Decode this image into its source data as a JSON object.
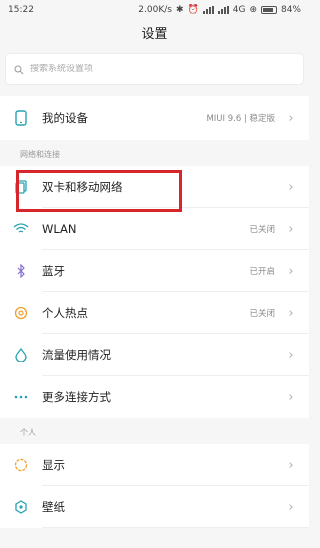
{
  "status_bar": {
    "time": "15:22",
    "speed": "2.00K/s",
    "network_type": "4G",
    "battery": "84%"
  },
  "header": {
    "title": "设置"
  },
  "search": {
    "placeholder": "搜索系统设置项"
  },
  "device": {
    "label": "我的设备",
    "value": "MIUI 9.6 | 稳定版"
  },
  "sections": {
    "network_title": "网络和连接",
    "personal_title": "个人"
  },
  "network_items": [
    {
      "label": "双卡和移动网络",
      "value": "",
      "icon": "sim-card-icon"
    },
    {
      "label": "WLAN",
      "value": "已关闭",
      "icon": "wifi-icon"
    },
    {
      "label": "蓝牙",
      "value": "已开启",
      "icon": "bluetooth-icon"
    },
    {
      "label": "个人热点",
      "value": "已关闭",
      "icon": "hotspot-icon"
    },
    {
      "label": "流量使用情况",
      "value": "",
      "icon": "data-usage-icon"
    },
    {
      "label": "更多连接方式",
      "value": "",
      "icon": "more-icon"
    }
  ],
  "personal_items": [
    {
      "label": "显示",
      "value": "",
      "icon": "display-icon"
    },
    {
      "label": "壁纸",
      "value": "",
      "icon": "wallpaper-icon"
    }
  ],
  "colors": {
    "highlight": "#d7262b",
    "accent_teal": "#27a3b3",
    "icon_orange": "#f0a030"
  }
}
